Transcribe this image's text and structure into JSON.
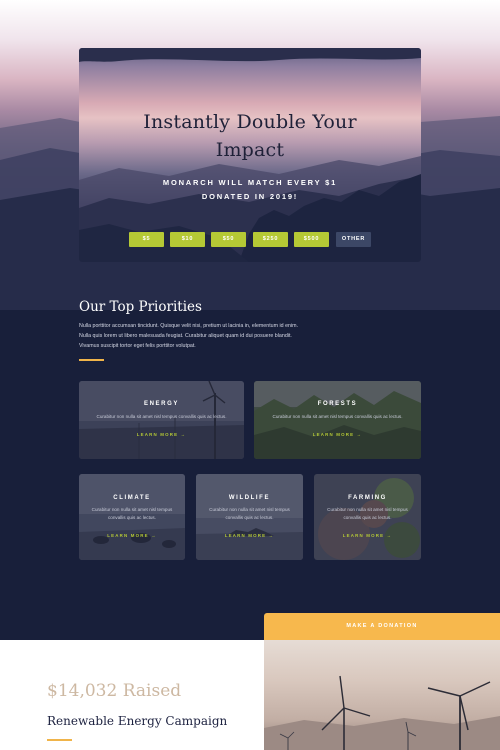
{
  "hero": {
    "title_line1": "Instantly Double Your",
    "title_line2": "Impact",
    "subtitle_line1": "MONARCH WILL MATCH EVERY $1",
    "subtitle_line2": "DONATED IN 2019!",
    "amounts": [
      "$5",
      "$10",
      "$50",
      "$250",
      "$500",
      "OTHER"
    ]
  },
  "priorities": {
    "title": "Our Top Priorities",
    "text": "Nulla porttitor accumsan tincidunt. Quisque velit nisi, pretium ut lacinia in, elementum id enim. Nulla quis lorem ut libero malesuada feugiat. Curabitur aliquet quam id dui posuere blandit. Vivamus suscipit tortor eget felis porttitor volutpat."
  },
  "cards": [
    {
      "label": "ENERGY",
      "desc": "Curabitur non nulla sit amet nisl tempus convallis quis ac lectus.",
      "link": "LEARN MORE →"
    },
    {
      "label": "FORESTS",
      "desc": "Curabitur non nulla sit amet nisl tempus convallis quis ac lectus.",
      "link": "LEARN MORE →"
    },
    {
      "label": "CLIMATE",
      "desc": "Curabitur non nulla sit amet nisl tempus convallis quis ac lectus.",
      "link": "LEARN MORE →"
    },
    {
      "label": "WILDLIFE",
      "desc": "Curabitur non nulla sit amet nisl tempus convallis quis ac lectus.",
      "link": "LEARN MORE →"
    },
    {
      "label": "FARMING",
      "desc": "Curabitur non nulla sit amet nisl tempus convallis quis ac lectus.",
      "link": "LEARN MORE →"
    }
  ],
  "campaign": {
    "donate_label": "MAKE A DONATION",
    "raised": "$14,032 Raised",
    "name": "Renewable Energy Campaign"
  },
  "colors": {
    "navy": "#181f3a",
    "lime": "#b5c935",
    "orange": "#f7b84d",
    "tan": "#cdb8a2"
  }
}
